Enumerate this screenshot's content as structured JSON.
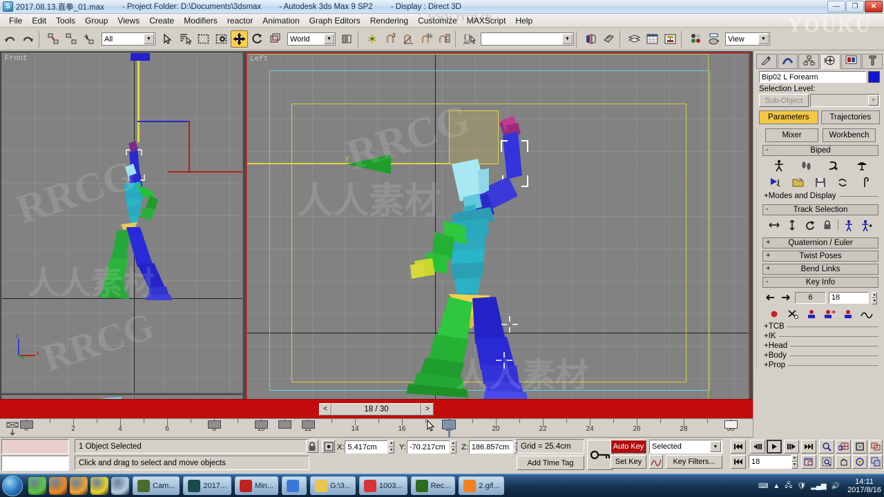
{
  "window": {
    "file_name": "2017.08.13.直拳_01.max",
    "project_folder": "- Project Folder: D:\\Documents\\3dsmax",
    "app_version": "- Autodesk 3ds Max 9 SP2",
    "display_mode": "- Display : Direct 3D",
    "minimize": "—",
    "restore": "❐",
    "close": "✕",
    "app_icon": "3ds-max-icon"
  },
  "menu": {
    "items": [
      "File",
      "Edit",
      "Tools",
      "Group",
      "Views",
      "Create",
      "Modifiers",
      "reactor",
      "Animation",
      "Graph Editors",
      "Rendering",
      "Customize",
      "MAXScript",
      "Help"
    ]
  },
  "toolbar": {
    "selection_filter": "All",
    "reference_coordinate_system": "World",
    "named_selection_set": "",
    "viewport_shading": "View",
    "buttons": [
      {
        "name": "undo-button",
        "glyph": "↶"
      },
      {
        "name": "redo-button",
        "glyph": "↷"
      },
      {
        "name": "select-and-link-button",
        "glyph": "⛓"
      },
      {
        "name": "unlink-selection-button",
        "glyph": "⛓"
      },
      {
        "name": "bind-to-space-warp-button",
        "glyph": "✦"
      },
      {
        "name": "select-object-button",
        "glyph": "➤"
      },
      {
        "name": "select-by-name-button",
        "glyph": "☰"
      },
      {
        "name": "rectangular-selection-region-button",
        "glyph": "▢"
      },
      {
        "name": "window-crossing-toggle-button",
        "glyph": "◪"
      },
      {
        "name": "select-and-move-button",
        "glyph": "✥"
      },
      {
        "name": "select-and-rotate-button",
        "glyph": "↻"
      },
      {
        "name": "select-and-scale-button",
        "glyph": "◰"
      },
      {
        "name": "use-center-flyout-button",
        "glyph": "◧"
      },
      {
        "name": "select-and-manipulate-button",
        "glyph": "✧"
      },
      {
        "name": "snaps-toggle-button",
        "glyph": "3"
      },
      {
        "name": "angle-snap-toggle-button",
        "glyph": "∠"
      },
      {
        "name": "percent-snap-toggle-button",
        "glyph": "%"
      },
      {
        "name": "spinner-snap-toggle-button",
        "glyph": "⇅"
      },
      {
        "name": "named-selection-sets-button",
        "glyph": "{}"
      },
      {
        "name": "mirror-button",
        "glyph": "◨"
      },
      {
        "name": "align-button",
        "glyph": "◈"
      },
      {
        "name": "layer-manager-button",
        "glyph": "▤"
      },
      {
        "name": "curve-editor-button",
        "glyph": "▦"
      },
      {
        "name": "schematic-view-button",
        "glyph": "▣"
      },
      {
        "name": "material-editor-button",
        "glyph": "◉"
      },
      {
        "name": "render-scene-button",
        "glyph": "☕"
      }
    ]
  },
  "viewports": [
    {
      "name": "viewport-front",
      "label": "Front",
      "active": false
    },
    {
      "name": "viewport-top",
      "label": "",
      "active": false
    },
    {
      "name": "viewport-left",
      "label": "Left",
      "active": true
    }
  ],
  "axis_tripod": {
    "z": "z",
    "x": "x"
  },
  "time_slider": {
    "prev_frame": "<",
    "next_frame": ">",
    "current_label": "18 / 30"
  },
  "track_bar": {
    "tick_labels": [
      "0",
      "2",
      "4",
      "6",
      "8",
      "10",
      "12",
      "14",
      "16",
      "18",
      "20",
      "22",
      "24",
      "26",
      "28",
      "30"
    ],
    "key_frames": [
      0,
      8,
      10,
      11,
      12,
      18,
      30
    ],
    "current_frame": 18,
    "range_start": 0,
    "range_end": 30
  },
  "status": {
    "selection_text": "1 Object Selected",
    "prompt_text": "Click and drag to select and move objects",
    "x_label": "X:",
    "x_value": "5.417cm",
    "y_label": "Y:",
    "y_value": "-70.217cm",
    "z_label": "Z:",
    "z_value": "186.857cm",
    "grid_text": "Grid = 25.4cm",
    "add_time_tag": "Add Time Tag",
    "lock_icon": "lock-icon",
    "absolute_mode_icon": "absolute-relative-transform-icon",
    "key_mode_icon": "key-mode-icon"
  },
  "animation": {
    "auto_key": "Auto Key",
    "set_key": "Set Key",
    "key_filters": "Key Filters...",
    "selection_list": "Selected",
    "frame_field": "18",
    "playback_buttons": [
      {
        "name": "go-to-start-button",
        "glyph": "|◀◀"
      },
      {
        "name": "previous-frame-button",
        "glyph": "◀|"
      },
      {
        "name": "play-animation-button",
        "glyph": "▶"
      },
      {
        "name": "next-frame-button",
        "glyph": "|▶"
      },
      {
        "name": "go-to-end-button",
        "glyph": "▶▶|"
      }
    ],
    "key_mode_toggle": "key-mode-toggle-icon",
    "nav_buttons": [
      {
        "name": "zoom-button",
        "glyph": "🔍"
      },
      {
        "name": "zoom-all-button",
        "glyph": "⊞"
      },
      {
        "name": "zoom-extents-button",
        "glyph": "⬚"
      },
      {
        "name": "zoom-extents-all-button",
        "glyph": "⊟"
      },
      {
        "name": "field-of-view-button",
        "glyph": "◳"
      },
      {
        "name": "zoom-region-button",
        "glyph": "⬓"
      },
      {
        "name": "pan-view-button",
        "glyph": "✋"
      },
      {
        "name": "arc-rotate-button",
        "glyph": "⟳"
      },
      {
        "name": "maximize-viewport-toggle-button",
        "glyph": "⤢"
      }
    ]
  },
  "command_panel": {
    "tabs": [
      {
        "name": "create-tab",
        "icon": "wand-icon",
        "selected": false
      },
      {
        "name": "modify-tab",
        "icon": "arc-icon",
        "selected": false
      },
      {
        "name": "hierarchy-tab",
        "icon": "hierarchy-icon",
        "selected": false
      },
      {
        "name": "motion-tab",
        "icon": "wheel-icon",
        "selected": true
      },
      {
        "name": "display-tab",
        "icon": "monitor-icon",
        "selected": false
      },
      {
        "name": "utilities-tab",
        "icon": "hammer-icon",
        "selected": false
      }
    ],
    "object_name": "Bip02 L Forearm",
    "object_color": "#1414d6",
    "selection_level_label": "Selection Level:",
    "sub_object_button": "Sub-Object",
    "sub_object_value": "",
    "parameters_button": "Parameters",
    "trajectories_button": "Trajectories",
    "mixer_button": "Mixer",
    "workbench_button": "Workbench",
    "rollouts": [
      {
        "name": "rollout-biped",
        "label": "Biped",
        "state": "-"
      },
      {
        "name": "rollout-modes-and-display",
        "label": "+Modes and Display",
        "flat": true
      },
      {
        "name": "rollout-track-selection",
        "label": "Track Selection",
        "state": "-"
      },
      {
        "name": "rollout-quaternion-euler",
        "label": "Quaternion / Euler",
        "state": "+"
      },
      {
        "name": "rollout-twist-poses",
        "label": "Twist Poses",
        "state": "+"
      },
      {
        "name": "rollout-bend-links",
        "label": "Bend Links",
        "state": "+"
      },
      {
        "name": "rollout-key-info",
        "label": "Key Info",
        "state": "-"
      }
    ],
    "biped_icons": [
      {
        "name": "figure-mode-icon",
        "glyph": "🚶"
      },
      {
        "name": "footstep-mode-icon",
        "glyph": "👣"
      },
      {
        "name": "motion-flow-mode-icon",
        "glyph": "↯"
      },
      {
        "name": "mixer-mode-icon",
        "glyph": "🍄"
      },
      {
        "name": "biped-playback-icon",
        "glyph": "▶"
      },
      {
        "name": "load-file-icon",
        "glyph": "📂"
      },
      {
        "name": "save-file-icon",
        "glyph": "💾"
      },
      {
        "name": "convert-icon",
        "glyph": "⟳"
      },
      {
        "name": "move-all-mode-icon",
        "glyph": "ϐ"
      }
    ],
    "track_selection_icons": [
      {
        "name": "body-horizontal-icon",
        "glyph": "↔"
      },
      {
        "name": "body-vertical-icon",
        "glyph": "↕"
      },
      {
        "name": "body-rotation-icon",
        "glyph": "↻"
      },
      {
        "name": "lock-com-keying-icon",
        "glyph": "🔒"
      },
      {
        "name": "symmetrical-tracks-icon",
        "glyph": "🚶"
      },
      {
        "name": "opposite-tracks-icon",
        "glyph": "🚶"
      }
    ],
    "key_info": {
      "prev_key_icon": "previous-key-icon",
      "next_key_icon": "next-key-icon",
      "key_number": "6",
      "frame_value": "18",
      "buttons": [
        {
          "name": "set-key-icon",
          "glyph": "●"
        },
        {
          "name": "delete-key-icon",
          "glyph": "✂"
        },
        {
          "name": "set-planted-key-icon",
          "glyph": "●"
        },
        {
          "name": "set-sliding-key-icon",
          "glyph": "●"
        },
        {
          "name": "set-free-key-icon",
          "glyph": "●"
        },
        {
          "name": "trajectories-curve-icon",
          "glyph": "∿"
        }
      ]
    },
    "sub_rollouts": [
      "+TCB",
      "+IK",
      "+Head",
      "+Body",
      "+Prop"
    ]
  },
  "taskbar": {
    "start_button": "start-orb",
    "quick_launch": [
      {
        "name": "ql-browser-icon",
        "color": "#5ec840"
      },
      {
        "name": "ql-foot-icon",
        "color": "#f08a20"
      },
      {
        "name": "ql-target-icon",
        "color": "#f2a134"
      },
      {
        "name": "ql-music-icon",
        "color": "#e8d12a"
      },
      {
        "name": "ql-notes-icon",
        "color": "#b8cfe0"
      }
    ],
    "tasks": [
      {
        "name": "task-camtasia",
        "label": "Cam...",
        "color": "#4c6b2e"
      },
      {
        "name": "task-3dsmax",
        "label": "2017...",
        "color": "#1a4a4a"
      },
      {
        "name": "task-mindmanager",
        "label": "Min...",
        "color": "#c02020"
      },
      {
        "name": "task-chrome",
        "label": "",
        "color": "#3b78d8"
      },
      {
        "name": "task-folder",
        "label": "G:\\3...",
        "color": "#e8c64a"
      },
      {
        "name": "task-player",
        "label": "1003...",
        "color": "#d83434"
      },
      {
        "name": "task-recorder",
        "label": "Rec...",
        "color": "#2f6b1f"
      },
      {
        "name": "task-gif",
        "label": "2.gif...",
        "color": "#f08020"
      }
    ],
    "tray_icons": [
      "keyboard-icon",
      "show-hidden-icon",
      "network-icon",
      "security-icon",
      "signal-icon",
      "volume-icon"
    ],
    "clock_time": "14:11",
    "clock_date": "2017/8/16"
  },
  "watermarks": {
    "rrcg_1": "RRCG",
    "rrcg_2": "RRCG",
    "rrcg_3": "RRCG",
    "chinese": "人人素材",
    "youku": "YOUKU",
    "site": "www.rrcg.cn"
  }
}
